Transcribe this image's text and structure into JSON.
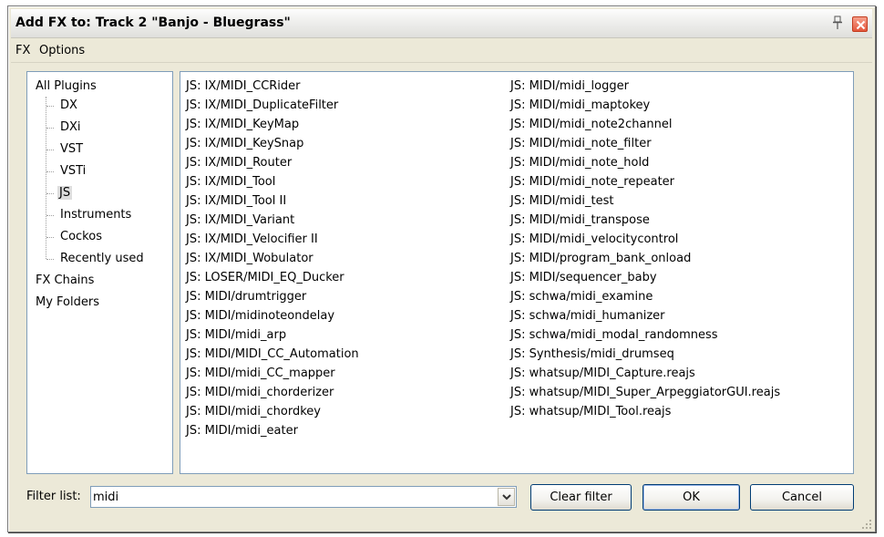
{
  "window": {
    "title": "Add FX to: Track 2 \"Banjo - Bluegrass\""
  },
  "menu": [
    "FX",
    "Options"
  ],
  "tree": {
    "root": "All Plugins",
    "children": [
      "DX",
      "DXi",
      "VST",
      "VSTi",
      "JS",
      "Instruments",
      "Cockos",
      "Recently used"
    ],
    "selected": "JS",
    "others": [
      "FX Chains",
      "My Folders"
    ]
  },
  "plugins_col1": [
    "JS: IX/MIDI_CCRider",
    "JS: IX/MIDI_DuplicateFilter",
    "JS: IX/MIDI_KeyMap",
    "JS: IX/MIDI_KeySnap",
    "JS: IX/MIDI_Router",
    "JS: IX/MIDI_Tool",
    "JS: IX/MIDI_Tool II",
    "JS: IX/MIDI_Variant",
    "JS: IX/MIDI_Velocifier II",
    "JS: IX/MIDI_Wobulator",
    "JS: LOSER/MIDI_EQ_Ducker",
    "JS: MIDI/drumtrigger",
    "JS: MIDI/midinoteondelay",
    "JS: MIDI/midi_arp",
    "JS: MIDI/MIDI_CC_Automation",
    "JS: MIDI/midi_CC_mapper",
    "JS: MIDI/midi_chorderizer",
    "JS: MIDI/midi_chordkey",
    "JS: MIDI/midi_eater"
  ],
  "plugins_col2": [
    "JS: MIDI/midi_logger",
    "JS: MIDI/midi_maptokey",
    "JS: MIDI/midi_note2channel",
    "JS: MIDI/midi_note_filter",
    "JS: MIDI/midi_note_hold",
    "JS: MIDI/midi_note_repeater",
    "JS: MIDI/midi_test",
    "JS: MIDI/midi_transpose",
    "JS: MIDI/midi_velocitycontrol",
    "JS: MIDI/program_bank_onload",
    "JS: MIDI/sequencer_baby",
    "JS: schwa/midi_examine",
    "JS: schwa/midi_humanizer",
    "JS: schwa/midi_modal_randomness",
    "JS: Synthesis/midi_drumseq",
    "JS: whatsup/MIDI_Capture.reajs",
    "JS: whatsup/MIDI_Super_ArpeggiatorGUI.reajs",
    "JS: whatsup/MIDI_Tool.reajs"
  ],
  "filter": {
    "label": "Filter list:",
    "value": "midi"
  },
  "buttons": {
    "clear": "Clear filter",
    "ok": "OK",
    "cancel": "Cancel"
  },
  "icons": {
    "pin": "pin-icon",
    "close": "close-icon",
    "dropdown": "chevron-down-icon",
    "grip": "resize-grip-icon"
  },
  "colors": {
    "close": "#e4583d",
    "border": "#7f9db9",
    "window": "#ece9d8",
    "selection": "#dedede"
  }
}
